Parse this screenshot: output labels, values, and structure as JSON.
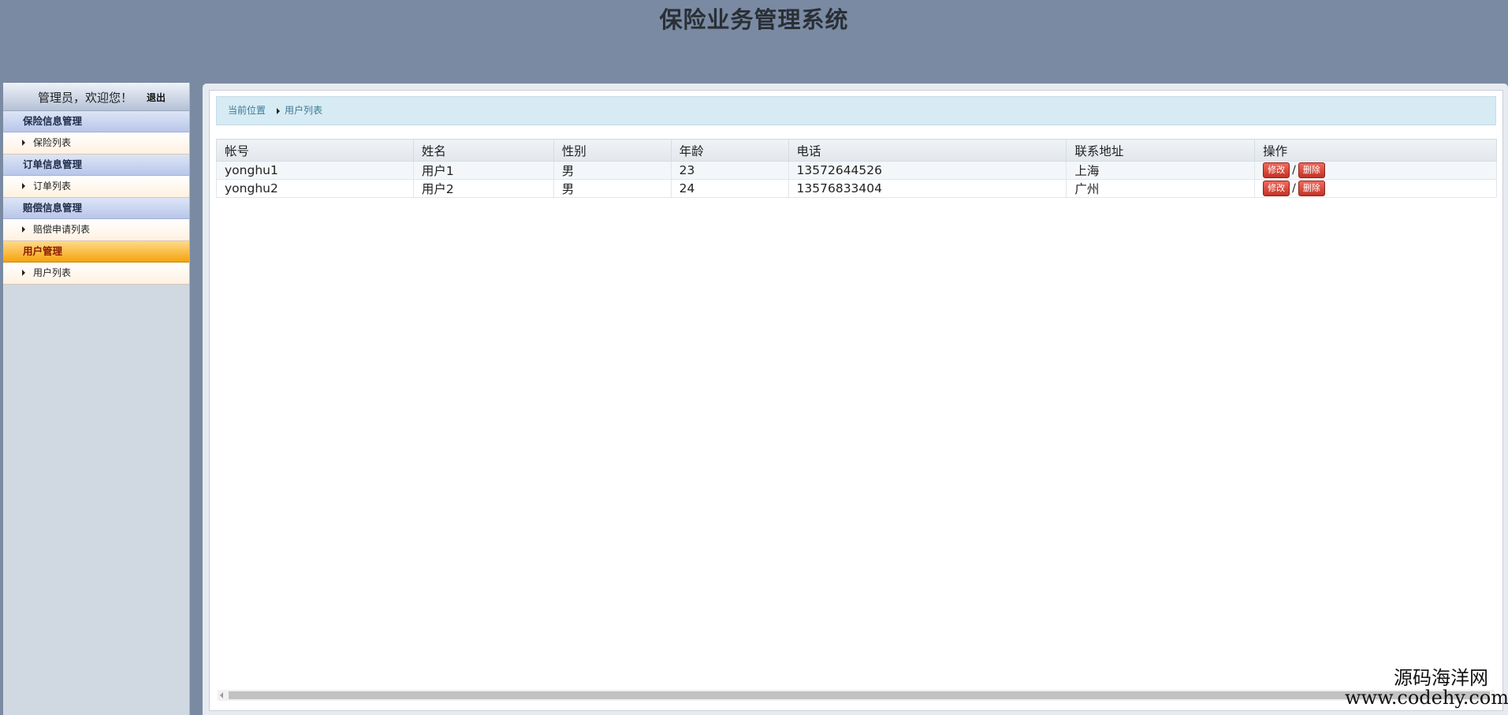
{
  "app": {
    "title": "保险业务管理系统"
  },
  "sidebar": {
    "welcome": "管理员，欢迎您！",
    "logout_label": "退出",
    "groups": [
      {
        "label": "保险信息管理",
        "items": [
          {
            "label": "保险列表"
          }
        ]
      },
      {
        "label": "订单信息管理",
        "items": [
          {
            "label": "订单列表"
          }
        ]
      },
      {
        "label": "赔偿信息管理",
        "items": [
          {
            "label": "赔偿申请列表"
          }
        ]
      },
      {
        "label": "用户管理",
        "items": [
          {
            "label": "用户列表"
          }
        ]
      }
    ]
  },
  "breadcrumb": {
    "home": "当前位置",
    "current": "用户列表"
  },
  "table": {
    "columns": [
      "帐号",
      "姓名",
      "性别",
      "年龄",
      "电话",
      "联系地址",
      "操作"
    ],
    "rows": [
      {
        "account": "yonghu1",
        "name": "用户1",
        "gender": "男",
        "age": "23",
        "phone": "13572644526",
        "address": "上海"
      },
      {
        "account": "yonghu2",
        "name": "用户2",
        "gender": "男",
        "age": "24",
        "phone": "13576833404",
        "address": "广州"
      }
    ],
    "edit_label": "修改",
    "delete_label": "删除",
    "separator": "/"
  },
  "watermark": {
    "name": "源码海洋网",
    "url": "www.codehy.com"
  },
  "colors": {
    "background": "#7a8aa2",
    "active_menu": "#f4a40e",
    "danger_button": "#c23326",
    "breadcrumb_bg": "#d7ebf4"
  }
}
